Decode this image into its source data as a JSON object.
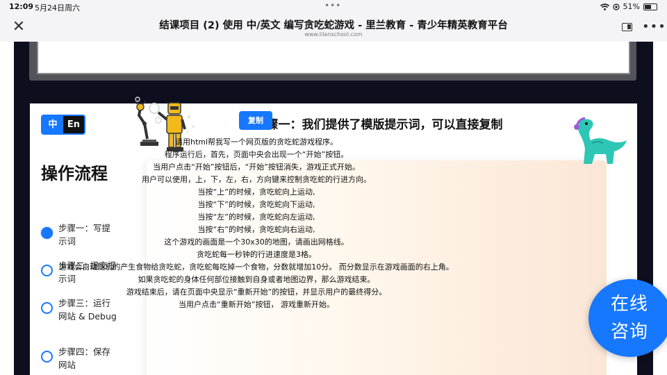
{
  "status_bar": {
    "time": "12:09",
    "date": "5月24日周六",
    "dots": "•••",
    "battery": "51%",
    "battery_level": 0.51
  },
  "browser": {
    "title": "结课项目 (2) 使用 中/英文 编写贪吃蛇游戏 - 里兰教育 - 青少年精英教育平台",
    "url": "www.lilanschool.com",
    "close_symbol": "✕",
    "more_symbol": "•••"
  },
  "sidebar": {
    "lang_zh": "中",
    "lang_en": "En",
    "title": "操作流程",
    "steps": [
      {
        "label": "步骤一：写提示词",
        "active": true
      },
      {
        "label": "步骤二: 提交提示词",
        "active": false
      },
      {
        "label": "步骤三：运行网站 & Debug",
        "active": false
      },
      {
        "label": "步骤四：保存网站",
        "active": false
      }
    ]
  },
  "main": {
    "heading": "步骤一：我们提供了模版提示词，可以直接复制",
    "copy_label": "复制",
    "prompt_lines": [
      "请用html帮我写一个网页版的贪吃蛇游戏程序。",
      "程序运行后，首先，页面中央会出现一个“开始”按钮。",
      "当用户点击“开始”按钮后，“开始”按钮消失，游戏正式开始。",
      "用户可以使用，上，下，左，右，方向键来控制贪吃蛇的行进方向。",
      "当按“上”的时候，贪吃蛇向上运动,",
      "当按“下”的时候，贪吃蛇向下运动,",
      "当按“左”的时候，贪吃蛇向左运动,",
      "当按“右”的时候，贪吃蛇向右运动,",
      "这个游戏的画面是一个30x30的地图，请画出网格线。",
      "贪吃蛇每一秒钟的行进速度是3格。",
      "游戏会自动随机的产生食物给贪吃蛇，贪吃蛇每吃掉一个食物，分数就增加10分。 而分数显示在游戏画面的右上角。",
      "如果贪吃蛇的身体任何部位接触到自身或者地图边界，那么游戏结束。",
      "游戏结束后，请在页面中央显示“重新开始”的按钮，并显示用户的最终得分。",
      "当用户点击“重新开始”按钮， 游戏重新开始。"
    ]
  },
  "chat": {
    "label": "在线咨询"
  },
  "colors": {
    "accent": "#1677ff",
    "dark_bg": "#0d0f1f",
    "dino": "#2ec7b5"
  },
  "icons": [
    "close-icon",
    "more-icon",
    "split-view-icon",
    "wifi-icon",
    "battery-icon",
    "robot-illustration",
    "dinosaur-illustration"
  ]
}
